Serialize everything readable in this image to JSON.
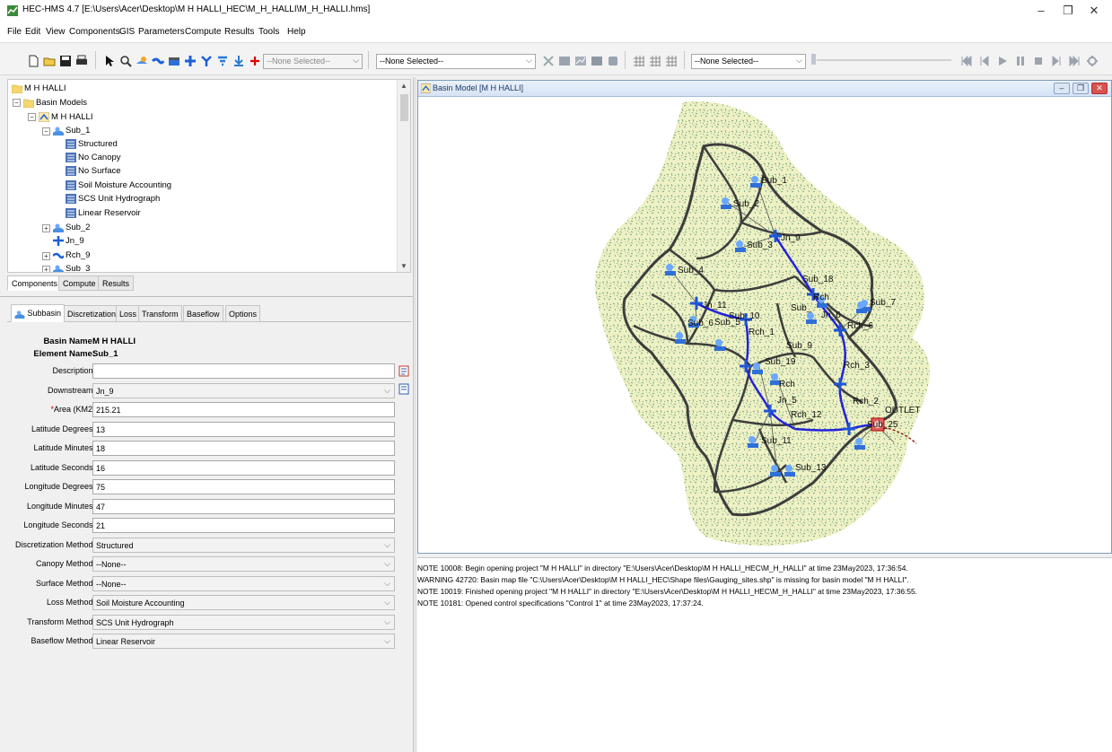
{
  "app": {
    "title": "HEC-HMS 4.7 [E:\\Users\\Acer\\Desktop\\M H HALLI_HEC\\M_H_HALLI\\M_H_HALLI.hms]",
    "window_controls": [
      "–",
      "❐",
      "✕"
    ]
  },
  "menu": [
    "File",
    "Edit",
    "View",
    "Components",
    "GIS",
    "Parameters",
    "Compute",
    "Results",
    "Tools",
    "Help"
  ],
  "toolbar": {
    "combo1": "--None Selected--",
    "combo2": "--None Selected--",
    "combo3": "--None Selected--"
  },
  "tree": {
    "root": "M H HALLI",
    "basin_models": "Basin Models",
    "basin": "M H HALLI",
    "sub1": "Sub_1",
    "methods": [
      "Structured",
      "No Canopy",
      "No Surface",
      "Soil Moisture Accounting",
      "SCS Unit Hydrograph",
      "Linear Reservoir"
    ],
    "sub2": "Sub_2",
    "jn9": "Jn_9",
    "rch9": "Rch_9",
    "sub3": "Sub_3"
  },
  "component_tabs": [
    "Components",
    "Compute",
    "Results"
  ],
  "property_tabs": [
    "Subbasin",
    "Discretization",
    "Loss",
    "Transform",
    "Baseflow",
    "Options"
  ],
  "element": {
    "basin_name_label": "Basin Name:",
    "basin_name": "M H HALLI",
    "element_name_label": "Element Name:",
    "element_name": "Sub_1"
  },
  "form": {
    "description": {
      "label": "Description:",
      "value": ""
    },
    "downstream": {
      "label": "Downstream:",
      "value": "Jn_9"
    },
    "area": {
      "req": "*",
      "label": "Area (KM2)",
      "value": "215.21"
    },
    "lat_deg": {
      "label": "Latitude Degrees:",
      "value": "13"
    },
    "lat_min": {
      "label": "Latitude Minutes:",
      "value": "18"
    },
    "lat_sec": {
      "label": "Latitude Seconds:",
      "value": "16"
    },
    "lon_deg": {
      "label": "Longitude Degrees:",
      "value": "75"
    },
    "lon_min": {
      "label": "Longitude Minutes:",
      "value": "47"
    },
    "lon_sec": {
      "label": "Longitude Seconds:",
      "value": "21"
    },
    "disc_method": {
      "label": "Discretization Method:",
      "value": "Structured"
    },
    "canopy_method": {
      "label": "Canopy Method:",
      "value": "--None--"
    },
    "surface_method": {
      "label": "Surface Method:",
      "value": "--None--"
    },
    "loss_method": {
      "label": "Loss Method:",
      "value": "Soil Moisture Accounting"
    },
    "transform_method": {
      "label": "Transform Method:",
      "value": "SCS Unit Hydrograph"
    },
    "baseflow_method": {
      "label": "Baseflow Method:",
      "value": "Linear Reservoir"
    }
  },
  "basin_window": {
    "title": "Basin Model [M H HALLI]"
  },
  "map_labels": {
    "sub_1": "Sub_1",
    "sub_2": "Sub_2",
    "jn_9": "Jn_9",
    "sub_3": "Sub_3",
    "sub_18": "Sub_18",
    "sub_4": "Sub_4",
    "jn_11": "Jn_11",
    "sub_10": "Sub_10",
    "rch": "Rch",
    "sub_": "Sub_",
    "jn_6": "Jn_6",
    "sub_7": "Sub_7",
    "sub_6": "Sub_6",
    "sub_5": "Sub_5",
    "rch_1": "Rch_1",
    "rch_6": "Rch_6",
    "sub_9": "Sub_9",
    "sub_19": "Sub_19",
    "rch_3": "Rch_3",
    "rch2": "Rch",
    "rch_2": "Rch_2",
    "jn_5": "Jn_5",
    "outlet": "OUTLET",
    "rch_12": "Rch_12",
    "sub_25": "Sub_25",
    "sub_11": "Sub_11",
    "sub_13": "Sub_13"
  },
  "console": [
    "NOTE 10008:  Begin opening project \"M H HALLI\" in directory \"E:\\Users\\Acer\\Desktop\\M H HALLI_HEC\\M_H_HALLI\" at time 23May2023, 17:36:54.",
    "WARNING 42720:  Basin map file \"C:\\Users\\Acer\\Desktop\\M H HALLI_HEC\\Shape files\\Gauging_sites.shp\" is missing for basin model \"M H HALLI\".",
    "NOTE 10019:  Finished opening project \"M H HALLI\" in directory \"E:\\Users\\Acer\\Desktop\\M H HALLI_HEC\\M_H_HALLI\" at time 23May2023, 17:36:55.",
    "NOTE 10181:  Opened control specifications \"Control 1\" at time 23May2023, 17:37:24."
  ]
}
